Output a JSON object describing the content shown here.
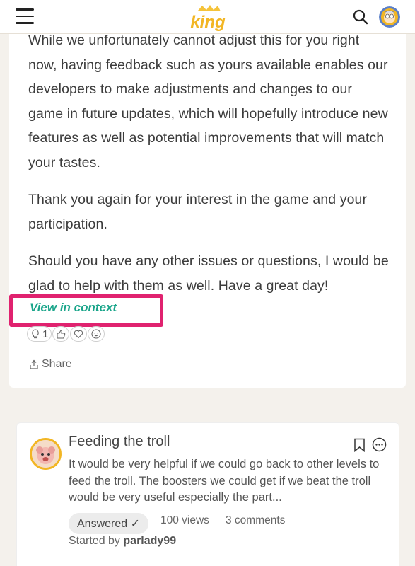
{
  "header": {
    "menu_icon": "hamburger-icon",
    "logo_text": "king",
    "search_icon": "search-icon",
    "avatar_icon": "user-avatar"
  },
  "post": {
    "paragraphs": [
      "While we unfortunately cannot adjust this for you right now, having feedback such as yours available enables our developers to make adjustments and changes to our game in future updates, which will hopefully introduce new features as well as potential improvements that will match your tastes.",
      "Thank you again for your interest in the game and your participation.",
      "Should you have any other issues or questions, I would be glad to help with them as well. Have a great day!"
    ],
    "view_in_context": "View in context",
    "reactions": [
      {
        "icon": "lightbulb-icon",
        "count": "1"
      },
      {
        "icon": "thumbs-up-icon",
        "count": ""
      },
      {
        "icon": "heart-icon",
        "count": ""
      },
      {
        "icon": "laugh-icon",
        "count": ""
      }
    ],
    "share_label": "Share"
  },
  "thread": {
    "title": "Feeding the troll",
    "excerpt": "It would be very helpful if we could go back to other levels to feed the troll. The boosters we could get if we beat the troll would be very useful especially the part...",
    "status_badge": "Answered ✓",
    "views": "100 views",
    "comments": "3 comments",
    "started_by_label": "Started by",
    "author": "parlady99"
  },
  "colors": {
    "accent_link": "#1aa58a",
    "highlight_border": "#e0226f",
    "logo_gold": "#f2b624",
    "background": "#f4f1ec"
  }
}
